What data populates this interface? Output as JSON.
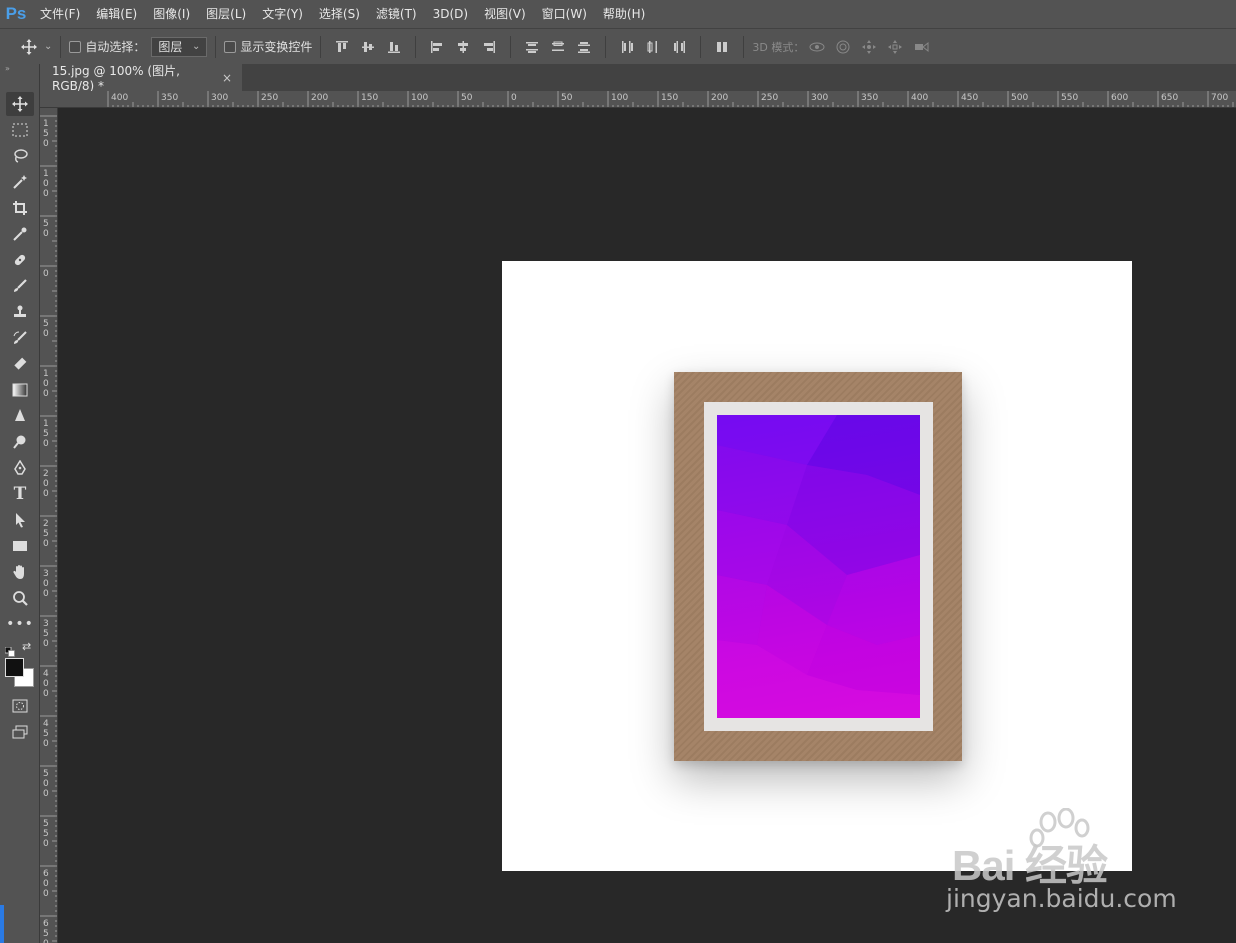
{
  "app": {
    "logo": "Ps"
  },
  "menu": [
    "文件(F)",
    "编辑(E)",
    "图像(I)",
    "图层(L)",
    "文字(Y)",
    "选择(S)",
    "滤镜(T)",
    "3D(D)",
    "视图(V)",
    "窗口(W)",
    "帮助(H)"
  ],
  "options": {
    "auto_select_label": "自动选择：",
    "auto_select_value": "图层",
    "show_transform_label": "显示变换控件",
    "mode_3d_label": "3D 模式："
  },
  "document": {
    "tab_title": "15.jpg @ 100% (图片, RGB/8) *",
    "close_glyph": "×"
  },
  "rulers": {
    "top_labels": [
      "400",
      "350",
      "300",
      "250",
      "200",
      "150",
      "100",
      "50",
      "0",
      "50",
      "100",
      "150",
      "200",
      "250",
      "300",
      "350",
      "400",
      "450",
      "500",
      "550",
      "600",
      "650",
      "700"
    ],
    "left_labels": [
      "150",
      "100",
      "50",
      "0",
      "50",
      "100",
      "150",
      "200",
      "250",
      "300",
      "350",
      "400",
      "450",
      "500",
      "550",
      "600",
      "650"
    ]
  },
  "watermark": {
    "brand": "Bai 经验",
    "url": "jingyan.baidu.com"
  },
  "colors": {
    "accent": "#4a9ee8",
    "frame": "#a58468",
    "mat": "#e6e4e3",
    "picture_top": "#6f0bf0",
    "picture_bottom": "#d609e0"
  }
}
